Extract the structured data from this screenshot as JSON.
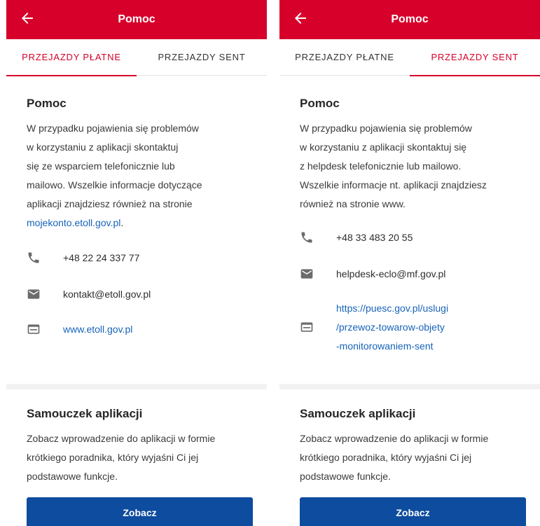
{
  "left_screen": {
    "header": {
      "title": "Pomoc"
    },
    "tabs": [
      {
        "label": "PRZEJAZDY PŁATNE",
        "active": true
      },
      {
        "label": "PRZEJAZDY SENT",
        "active": false
      }
    ],
    "help": {
      "title": "Pomoc",
      "lines": [
        "W przypadku pojawienia się problemów",
        "w korzystaniu z aplikacji skontaktuj",
        "się ze wsparciem telefonicznie lub",
        "mailowo. Wszelkie informacje dotyczące",
        "aplikacji znajdziesz również na stronie"
      ],
      "link_text": "mojekonto.etoll.gov.pl",
      "link_suffix": ".",
      "phone": "+48 22 24 337 77",
      "email": "kontakt@etoll.gov.pl",
      "website": "www.etoll.gov.pl"
    },
    "tutorial": {
      "title": "Samouczek aplikacji",
      "lines": [
        "Zobacz wprowadzenie do aplikacji w formie",
        "krótkiego poradnika, który wyjaśni Ci jej",
        "podstawowe funkcje."
      ],
      "button_label": "Zobacz"
    }
  },
  "right_screen": {
    "header": {
      "title": "Pomoc"
    },
    "tabs": [
      {
        "label": "PRZEJAZDY PŁATNE",
        "active": false
      },
      {
        "label": "PRZEJAZDY SENT",
        "active": true
      }
    ],
    "help": {
      "title": "Pomoc",
      "lines": [
        "W przypadku pojawienia się problemów",
        "w korzystaniu z aplikacji skontaktuj się",
        "z helpdesk telefonicznie lub mailowo.",
        "Wszelkie informacje nt. aplikacji znajdziesz",
        "również na stronie www."
      ],
      "phone": "+48 33 483 20 55",
      "email": "helpdesk-eclo@mf.gov.pl",
      "website_lines": [
        "https://puesc.gov.pl/uslugi",
        "/przewoz-towarow-objety",
        "-monitorowaniem-sent"
      ]
    },
    "tutorial": {
      "title": "Samouczek aplikacji",
      "lines": [
        "Zobacz wprowadzenie do aplikacji w formie",
        "krótkiego poradnika, który wyjaśni Ci jej",
        "podstawowe funkcje."
      ],
      "button_label": "Zobacz"
    }
  },
  "colors": {
    "header_red": "#d6002b",
    "link_blue": "#1763b8",
    "button_blue": "#0d4c9e",
    "icon_gray": "#6b6b6b"
  },
  "icons": [
    "arrow-left-icon",
    "phone-icon",
    "mail-icon",
    "web-window-icon"
  ]
}
